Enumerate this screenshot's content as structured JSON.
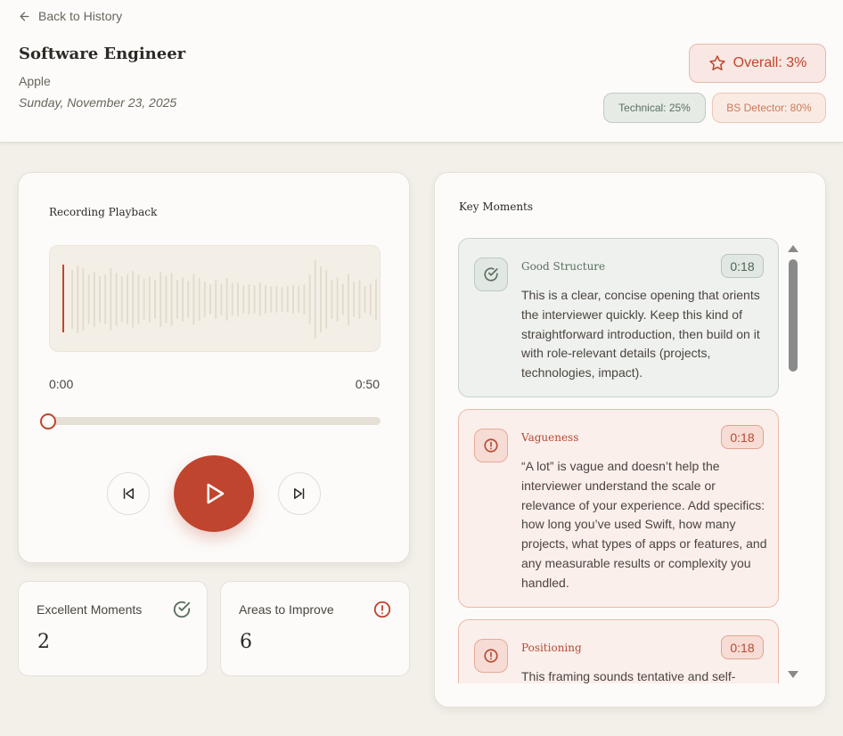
{
  "nav": {
    "back_label": "Back to History"
  },
  "header": {
    "job_title": "Software Engineer",
    "company": "Apple",
    "date": "Sunday, November 23, 2025"
  },
  "scores": {
    "overall": "Overall: 3%",
    "technical": "Technical: 25%",
    "bs_detector": "BS Detector: 80%"
  },
  "player": {
    "title": "Recording Playback",
    "time_current": "0:00",
    "time_total": "0:50",
    "progress_fraction": 0
  },
  "stats": {
    "excellent_label": "Excellent Moments",
    "excellent_value": "2",
    "improve_label": "Areas to Improve",
    "improve_value": "6"
  },
  "moments": {
    "title": "Key Moments",
    "items": [
      {
        "type": "good",
        "label": "Good Structure",
        "time": "0:18",
        "text": "This is a clear, concise opening that orients the interviewer quickly. Keep this kind of straightforward introduction, then build on it with role-relevant details (projects, technologies, impact)."
      },
      {
        "type": "bad",
        "label": "Vagueness",
        "time": "0:18",
        "text": "“A lot” is vague and doesn’t help the interviewer understand the scale or relevance of your experience. Add specifics: how long you’ve used Swift, how many projects, what types of apps or features, and any measurable results or complexity you handled."
      },
      {
        "type": "bad",
        "label": "Positioning",
        "time": "0:18",
        "text": "This framing sounds tentative and self-"
      }
    ]
  },
  "colors": {
    "accent": "#c0452e",
    "good": "#5a6f60",
    "background": "#f3efe9"
  }
}
